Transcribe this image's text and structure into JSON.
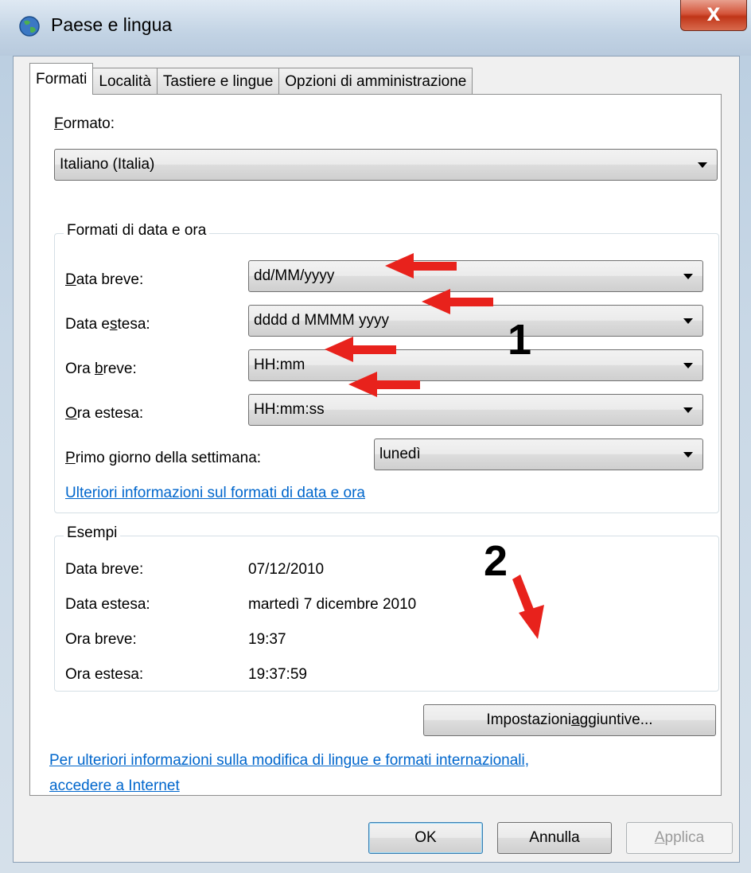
{
  "window": {
    "title": "Paese e lingua",
    "close_label": "X"
  },
  "tabs": [
    {
      "label": "Formati",
      "active": true
    },
    {
      "label": "Località",
      "active": false
    },
    {
      "label": "Tastiere e lingue",
      "active": false
    },
    {
      "label": "Opzioni di amministrazione",
      "active": false
    }
  ],
  "format": {
    "label_first": "F",
    "label_rest": "ormato:",
    "value": "Italiano (Italia)"
  },
  "datetime_group": {
    "title": "Formati di data e ora",
    "short_date": {
      "label_u": "D",
      "label_rest": "ata breve:",
      "value": "dd/MM/yyyy"
    },
    "long_date": {
      "label_pre": "Data e",
      "label_u": "s",
      "label_rest": "tesa:",
      "value": "dddd d MMMM yyyy"
    },
    "short_time": {
      "label_pre": "Ora ",
      "label_u": "b",
      "label_rest": "reve:",
      "value": "HH:mm"
    },
    "long_time": {
      "label_u": "O",
      "label_rest": "ra estesa:",
      "value": "HH:mm:ss"
    },
    "first_day": {
      "label_u": "P",
      "label_rest": "rimo giorno della settimana:",
      "value": "lunedì"
    },
    "link": "Ulteriori informazioni sul formati di data e ora"
  },
  "examples_group": {
    "title": "Esempi",
    "rows": [
      {
        "label": "Data breve:",
        "value": "07/12/2010"
      },
      {
        "label": "Data estesa:",
        "value": "martedì 7 dicembre 2010"
      },
      {
        "label": "Ora breve:",
        "value": "19:37"
      },
      {
        "label": "Ora estesa:",
        "value": "19:37:59"
      }
    ]
  },
  "additional_settings": {
    "label_pre": "Impostazioni ",
    "label_u": "a",
    "label_rest": "ggiuntive..."
  },
  "footer_link": {
    "line1": "Per ulteriori informazioni sulla modifica di lingue e formati internazionali,",
    "line2": "accedere a Internet"
  },
  "buttons": {
    "ok": "OK",
    "cancel": "Annulla",
    "apply_u": "A",
    "apply_rest": "pplica"
  },
  "annotations": {
    "marker1": "1",
    "marker2": "2",
    "arrow_color": "#e8221c"
  }
}
